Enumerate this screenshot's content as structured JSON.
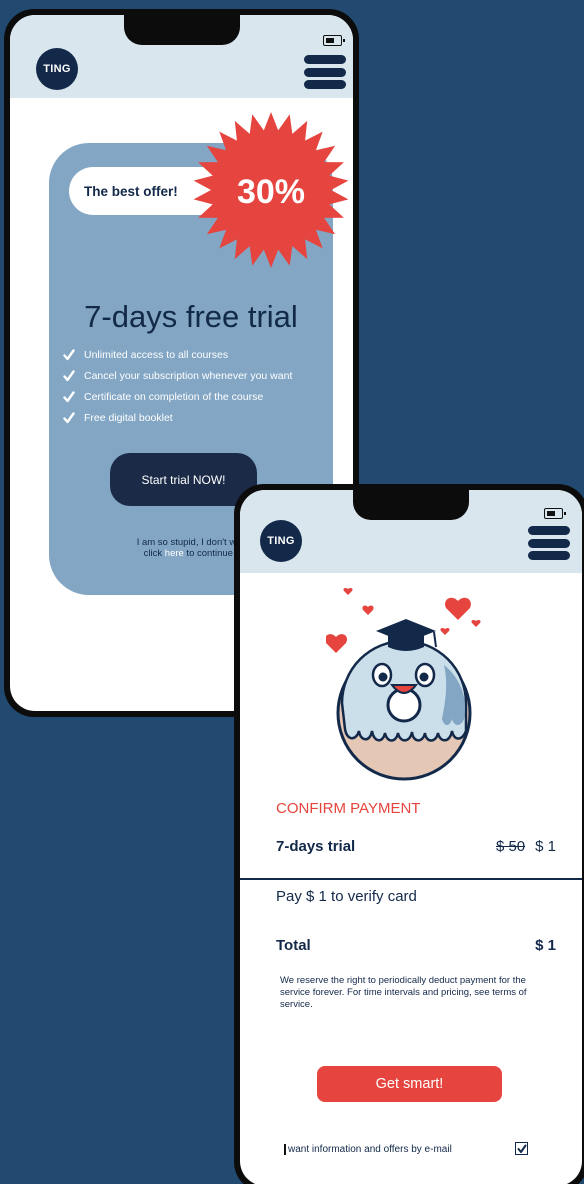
{
  "brand": {
    "logo_text": "TING",
    "accent": "#e5453e",
    "navy": "#13294a",
    "card_blue": "#82a6c4",
    "header_bg": "#d9e6ee",
    "page_bg": "#224a70"
  },
  "offer_screen": {
    "badge_label": "The best offer!",
    "discount": "30%",
    "title": "7-days free trial",
    "features": [
      "Unlimited access to all courses",
      "Cancel your subscription whenever you want",
      "Certificate on completion of the course",
      "Free digital booklet"
    ],
    "cta_label": "Start trial NOW!",
    "opt_out_line1": "I am so stupid, I don't want to save,",
    "opt_out_pre": "click ",
    "opt_out_link": "here",
    "opt_out_post": " to continue to website"
  },
  "payment_screen": {
    "heading": "CONFIRM PAYMENT",
    "plan_name": "7-days trial",
    "old_price": "$ 50",
    "new_price": "$ 1",
    "verify_text": "Pay $ 1 to verify card",
    "total_label": "Total",
    "total_value": "$ 1",
    "disclaimer": "We reserve the right to periodically deduct payment for the service forever. For time intervals and pricing, see terms of service.",
    "cta_label": "Get smart!",
    "email_opt_in": "want information and offers by e-mail",
    "email_opt_in_checked": true
  },
  "icons": {
    "menu": "hamburger-icon",
    "battery": "battery-icon",
    "check": "check-icon",
    "mascot": "donut-mascot-illustration"
  }
}
